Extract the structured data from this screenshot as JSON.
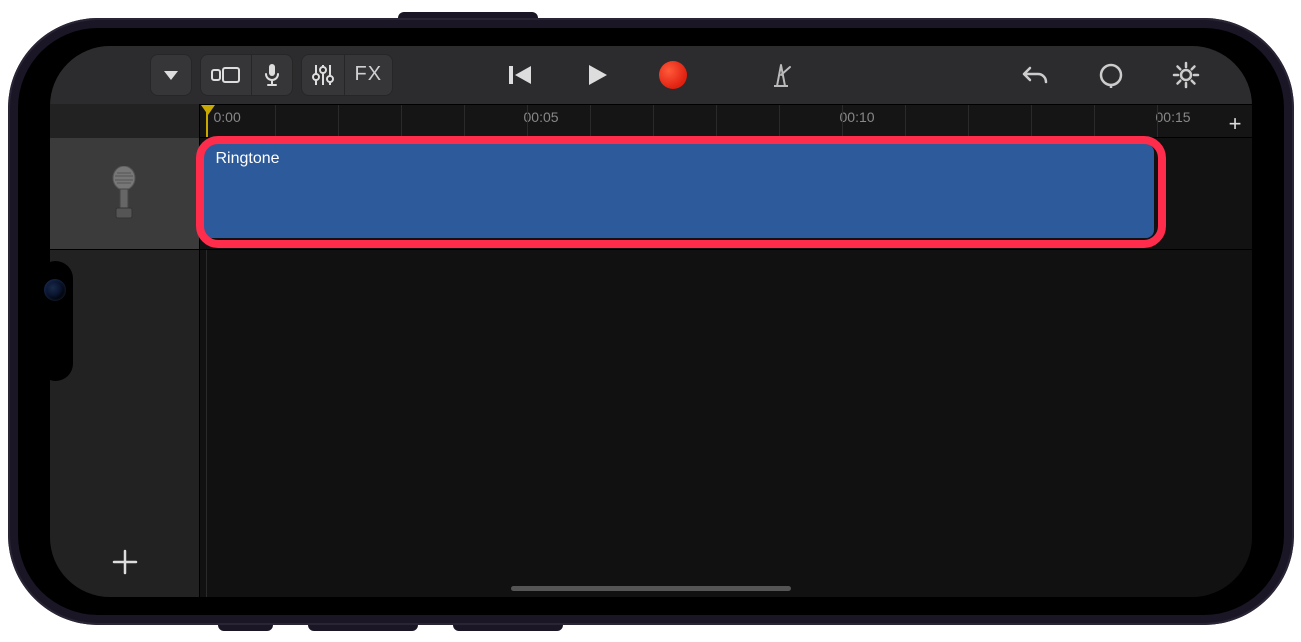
{
  "toolbar": {
    "fx_label": "FX"
  },
  "ruler": {
    "marks": [
      "0:00",
      "00:05",
      "00:10",
      "00:15"
    ],
    "playhead_at": "0:00"
  },
  "track": {
    "region_label": "Ringtone",
    "instrument": "microphone"
  },
  "highlight": {
    "target": "audio-region"
  }
}
